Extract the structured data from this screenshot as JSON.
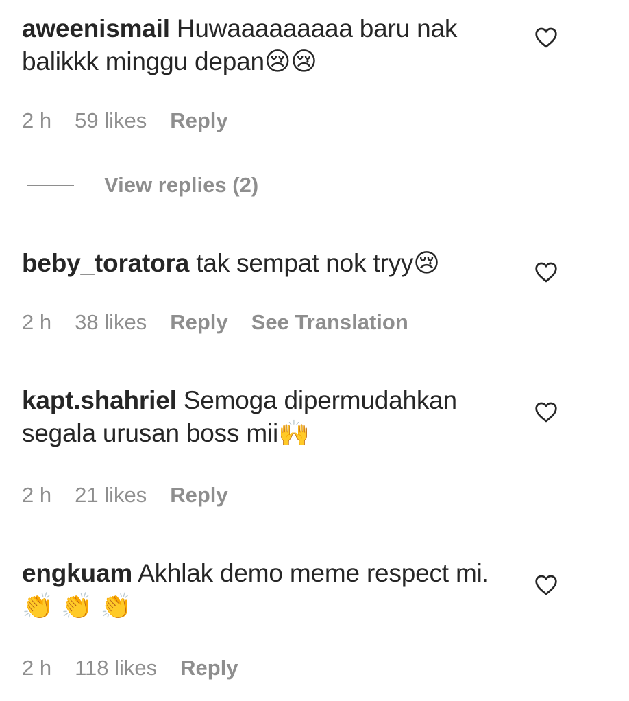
{
  "comments": [
    {
      "username": "aweenismail",
      "text": "Huwaaaaaaaaa baru nak balikkk minggu depan",
      "emoji": "😢😢",
      "time": "2 h",
      "likes": "59 likes",
      "reply": "Reply"
    },
    {
      "username": "beby_toratora",
      "text": "tak sempat nok tryy",
      "emoji": "😢",
      "time": "2 h",
      "likes": "38 likes",
      "reply": "Reply",
      "translate": "See Translation"
    },
    {
      "username": "kapt.shahriel",
      "text": "Semoga dipermudahkan segala urusan boss mii",
      "emoji": "🙌",
      "time": "2 h",
      "likes": "21 likes",
      "reply": "Reply"
    },
    {
      "username": "engkuam",
      "text": "Akhlak demo meme respect mi.",
      "emoji": " 👏 👏 👏",
      "time": "2 h",
      "likes": "118 likes",
      "reply": "Reply"
    }
  ],
  "view_replies": "View replies (2)",
  "icons": {
    "like": "heart-outline-icon"
  },
  "colors": {
    "text": "#262626",
    "secondary": "#8e8e8e"
  }
}
